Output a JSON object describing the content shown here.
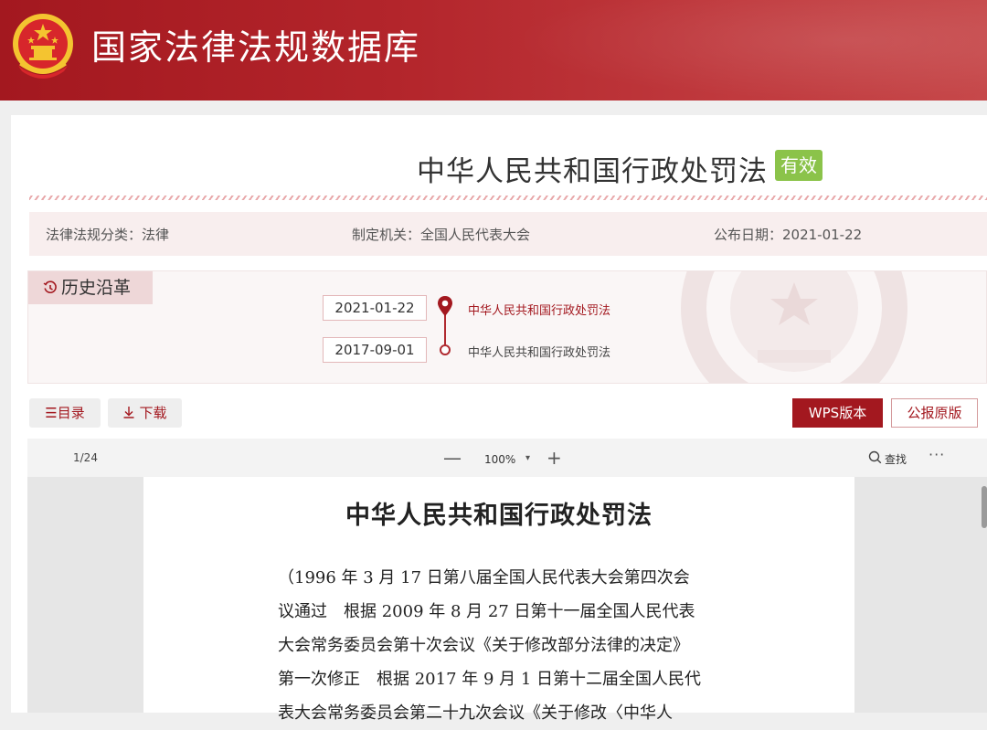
{
  "header": {
    "site_title": "国家法律法规数据库"
  },
  "law": {
    "title": "中华人民共和国行政处罚法",
    "status_badge": "有效"
  },
  "info": {
    "category": "法律法规分类：法律",
    "authority": "制定机关：全国人民代表大会",
    "publish_date": "公布日期：2021-01-22"
  },
  "history": {
    "label": "历史沿革",
    "entries": [
      {
        "date": "2021-01-22",
        "title": "中华人民共和国行政处罚法",
        "active": true
      },
      {
        "date": "2017-09-01",
        "title": "中华人民共和国行政处罚法",
        "active": false
      }
    ]
  },
  "toolbar": {
    "toc_label": "目录",
    "download_label": "下载",
    "wps_label": "WPS版本",
    "original_label": "公报原版"
  },
  "viewer": {
    "page_indicator": "1/24",
    "zoom_minus": "—",
    "zoom": "100%",
    "zoom_caret": "▾",
    "zoom_plus": "+",
    "find_label": "查找",
    "more": "···"
  },
  "document": {
    "title": "中华人民共和国行政处罚法",
    "lines": [
      "（1996 年 3 月 17 日第八届全国人民代表大会第四次会",
      "议通过　根据 2009 年 8 月 27 日第十一届全国人民代表",
      "大会常务委员会第十次会议《关于修改部分法律的决定》",
      "第一次修正　根据 2017 年 9 月 1 日第十二届全国人民代",
      "表大会常务委员会第二十九次会议《关于修改〈中华人"
    ]
  },
  "colors": {
    "brand_red": "#a3181f",
    "valid_green": "#8bc34a"
  }
}
